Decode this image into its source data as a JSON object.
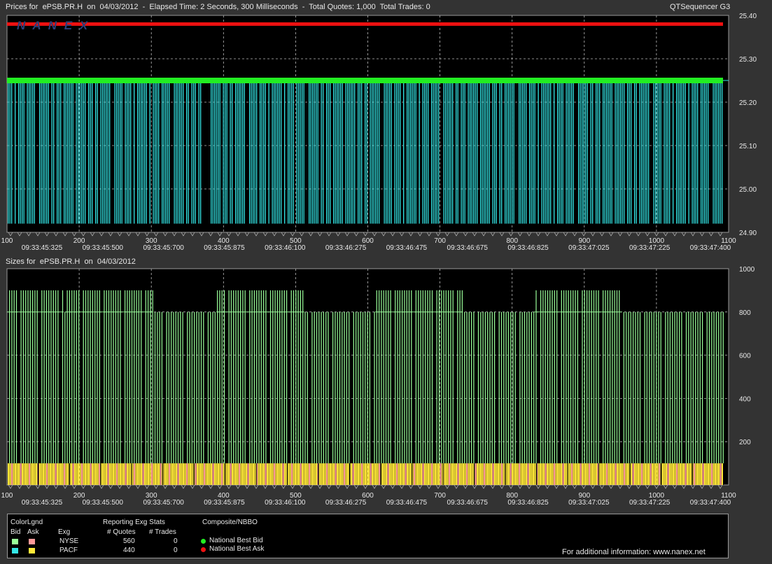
{
  "header": {
    "title": "Prices for  ePSB.PR.H  on  04/03/2012  -  Elapsed Time: 2 Seconds, 300 Milliseconds  -  Total Quotes: 1,000  Total Trades: 0",
    "app": "QTSequencer G3",
    "logo": "N A N E X"
  },
  "sizes_header": "Sizes for  ePSB.PR.H  on  04/03/2012",
  "colors": {
    "nyse_bid": "#99ff99",
    "nyse_ask": "#ff9999",
    "pacf_bid": "#33e6e6",
    "pacf_ask": "#ffe838",
    "nbbo_bid": "#22ee22",
    "nbbo_ask": "#ee1111"
  },
  "chart_data": [
    {
      "type": "bar",
      "title": "Prices for  ePSB.PR.H  on  04/03/2012",
      "x_ticks": [
        100,
        200,
        300,
        400,
        500,
        600,
        700,
        800,
        900,
        1000,
        1100
      ],
      "x_time_labels": [
        "09:33:45:325",
        "09:33:45:500",
        "09:33:45:700",
        "09:33:45:875",
        "09:33:46:100",
        "09:33:46:275",
        "09:33:46:475",
        "09:33:46:675",
        "09:33:46:825",
        "09:33:47:025",
        "09:33:47:225",
        "09:33:47:400"
      ],
      "y_ticks": [
        "25.40",
        "25.30",
        "25.20",
        "25.10",
        "25.00",
        "24.90"
      ],
      "ylim": [
        24.9,
        25.4
      ],
      "xlim": [
        100,
        1100
      ],
      "series": [
        {
          "name": "National Best Ask",
          "value": 25.38
        },
        {
          "name": "National Best Bid",
          "value": 25.25
        },
        {
          "name": "PACF bid",
          "value": 25.25,
          "floor": 24.92
        }
      ],
      "grid": true
    },
    {
      "type": "bar",
      "title": "Sizes for  ePSB.PR.H  on  04/03/2012",
      "x_ticks": [
        100,
        200,
        300,
        400,
        500,
        600,
        700,
        800,
        900,
        1000,
        1100
      ],
      "x_time_labels": [
        "09:33:45:325",
        "09:33:45:500",
        "09:33:45:700",
        "09:33:45:875",
        "09:33:46:100",
        "09:33:46:275",
        "09:33:46:475",
        "09:33:46:675",
        "09:33:46:825",
        "09:33:47:025",
        "09:33:47:225",
        "09:33:47:400"
      ],
      "y_ticks": [
        "1000",
        "800",
        "600",
        "400",
        "200"
      ],
      "ylim": [
        0,
        1000
      ],
      "xlim": [
        100,
        1100
      ],
      "bid_size_levels": [
        800,
        900
      ],
      "ask_size": 100,
      "high_segments": [
        [
          100,
          178
        ],
        [
          180,
          302
        ],
        [
          390,
          512
        ],
        [
          610,
          732
        ],
        [
          830,
          952
        ]
      ],
      "grid": true
    }
  ],
  "legend": {
    "color_legend_title": "ColorLgnd",
    "bid_label": "Bid",
    "ask_label": "Ask",
    "exg_label": "Exg",
    "stats_title": "Reporting Exg Stats",
    "quotes_header": "# Quotes",
    "trades_header": "# Trades",
    "rows": [
      {
        "exchange": "NYSE",
        "quotes": "560",
        "trades": "0"
      },
      {
        "exchange": "PACF",
        "quotes": "440",
        "trades": "0"
      }
    ],
    "nbbo_title": "Composite/NBBO",
    "nbbo_bid": "National Best Bid",
    "nbbo_ask": "National Best Ask",
    "footer": "For additional information: www.nanex.net"
  }
}
